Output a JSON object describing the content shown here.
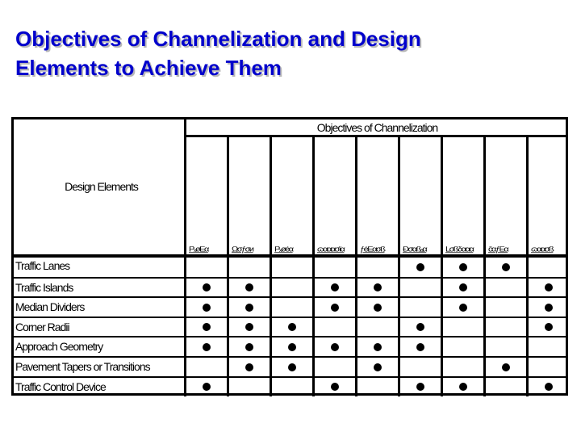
{
  "slide": {
    "title_lines": [
      "Objectives of Channelization and Design",
      "Elements to Achieve Them"
    ]
  },
  "matrix": {
    "corner_label": "Design Elements",
    "group_label": "Objectives of Channelization",
    "columns": [
      "PₓøĒα",
      "Ωσƒσи",
      "Pₓøéα",
      "ɷααασïα",
      "ƒéĒασß",
      "Ðσαßₐα",
      "Lσßδααα",
      "ĉαƒĒα",
      "ɷαασß"
    ],
    "dot_color": "#000000",
    "rows": [
      {
        "label": "Traffic Lanes",
        "marks": [
          false,
          false,
          false,
          false,
          false,
          true,
          true,
          true,
          false
        ]
      },
      {
        "label": "Traffic Islands",
        "marks": [
          true,
          true,
          false,
          true,
          true,
          false,
          true,
          false,
          true
        ]
      },
      {
        "label": "Median Dividers",
        "marks": [
          true,
          true,
          false,
          true,
          true,
          false,
          true,
          false,
          true
        ]
      },
      {
        "label": "Corner Radii",
        "marks": [
          true,
          true,
          true,
          false,
          false,
          true,
          false,
          false,
          true
        ]
      },
      {
        "label": "Approach Geometry",
        "marks": [
          true,
          true,
          true,
          true,
          true,
          true,
          false,
          false,
          false
        ]
      },
      {
        "label": "Pavement Tapers or Transitions",
        "marks": [
          false,
          true,
          true,
          false,
          true,
          false,
          false,
          true,
          false
        ]
      },
      {
        "label": "Traffic Control Device",
        "marks": [
          true,
          false,
          false,
          true,
          false,
          true,
          true,
          false,
          true
        ]
      }
    ]
  },
  "colors": {
    "title": "#0000cc",
    "title_shadow": "#b8b8b8",
    "grid": "#000000"
  }
}
